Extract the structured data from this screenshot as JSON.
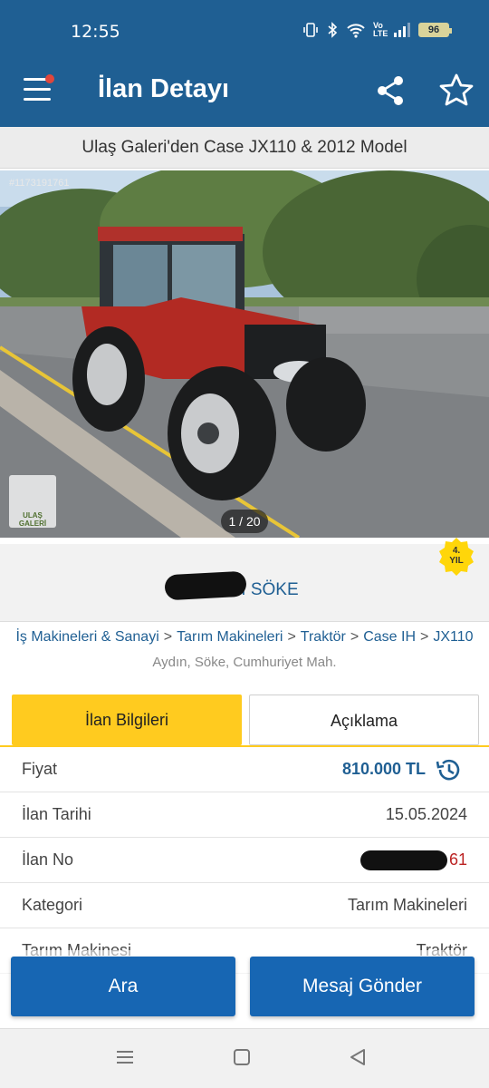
{
  "status": {
    "time": "12:55",
    "battery": "96",
    "icons": [
      "vibrate-icon",
      "bluetooth-icon",
      "wifi-icon",
      "volte-icon",
      "signal-icon",
      "battery-icon"
    ],
    "volte": "Vo LTE"
  },
  "appbar": {
    "title": "İlan Detayı",
    "icons": [
      "menu-icon",
      "share-icon",
      "star-icon"
    ],
    "accent": "#1f5f93",
    "notification_color": "#e0463c"
  },
  "listing": {
    "subtitle": "Ulaş Galeri'den Case JX110 & 2012 Model",
    "listing_no_overlay": "#1173191761",
    "image_counter": "1 / 20",
    "logo_text": "ULAŞ GALERİ"
  },
  "store": {
    "name": "U          LERİ SÖKE",
    "badge_number": "4.",
    "badge_label": "YIL",
    "badge_color": "#ffd60a"
  },
  "breadcrumb": {
    "items": [
      "İş Makineleri & Sanayi",
      "Tarım Makineleri",
      "Traktör",
      "Case IH",
      "JX110"
    ],
    "separator": ">",
    "location": "Aydın, Söke, Cumhuriyet Mah."
  },
  "tabs": {
    "active": "İlan Bilgileri",
    "inactive": "Açıklama",
    "active_color": "#ffcb1f"
  },
  "details": [
    {
      "key": "Fiyat",
      "value": "810.000 TL"
    },
    {
      "key": "İlan Tarihi",
      "value": "15.05.2024"
    },
    {
      "key": "İlan No",
      "value": "61"
    },
    {
      "key": "Kategori",
      "value": "Tarım Makineleri"
    },
    {
      "key": "Tarım Makinesi",
      "value": "Traktör"
    }
  ],
  "actions": {
    "call": "Ara",
    "message": "Mesaj Gönder",
    "button_color": "#1766b3"
  },
  "navbar": {
    "icons": [
      "recents-icon",
      "home-icon",
      "back-icon"
    ]
  }
}
